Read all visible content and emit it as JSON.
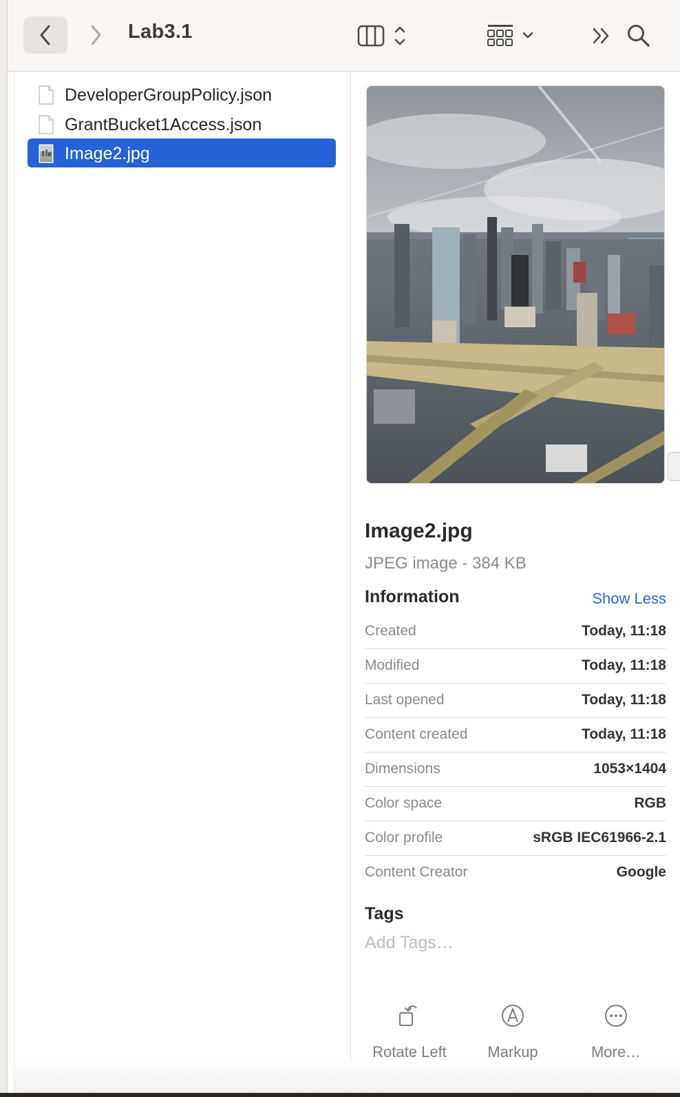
{
  "toolbar": {
    "title": "Lab3.1",
    "back_icon": "chevron-left-icon",
    "forward_icon": "chevron-right-icon",
    "view_icon": "column-view-icon",
    "group_icon": "icon-grid-icon",
    "more_icon": "double-chevron-right-icon",
    "search_icon": "magnifier-icon"
  },
  "files": [
    {
      "name": "DeveloperGroupPolicy.json",
      "icon": "document-icon",
      "selected": false
    },
    {
      "name": "GrantBucket1Access.json",
      "icon": "document-icon",
      "selected": false
    },
    {
      "name": "Image2.jpg",
      "icon": "image-thumbnail-icon",
      "selected": true
    }
  ],
  "preview": {
    "name": "Image2.jpg",
    "kind": "JPEG image - 384 KB",
    "info_heading": "Information",
    "show_less": "Show Less",
    "info": [
      {
        "label": "Created",
        "value": "Today, 11:18"
      },
      {
        "label": "Modified",
        "value": "Today, 11:18"
      },
      {
        "label": "Last opened",
        "value": "Today, 11:18"
      },
      {
        "label": "Content created",
        "value": "Today, 11:18"
      },
      {
        "label": "Dimensions",
        "value": "1053×1404"
      },
      {
        "label": "Color space",
        "value": "RGB"
      },
      {
        "label": "Color profile",
        "value": "sRGB IEC61966-2.1"
      },
      {
        "label": "Content Creator",
        "value": "Google"
      }
    ],
    "tags_heading": "Tags",
    "tags_placeholder": "Add Tags…",
    "actions": [
      {
        "label": "Rotate Left",
        "icon": "rotate-left-icon"
      },
      {
        "label": "Markup",
        "icon": "markup-icon"
      },
      {
        "label": "More…",
        "icon": "more-icon"
      }
    ]
  },
  "colors": {
    "selection": "#2562d8",
    "link": "#2a67d4",
    "toolbar_bg": "#f8f5f2"
  }
}
